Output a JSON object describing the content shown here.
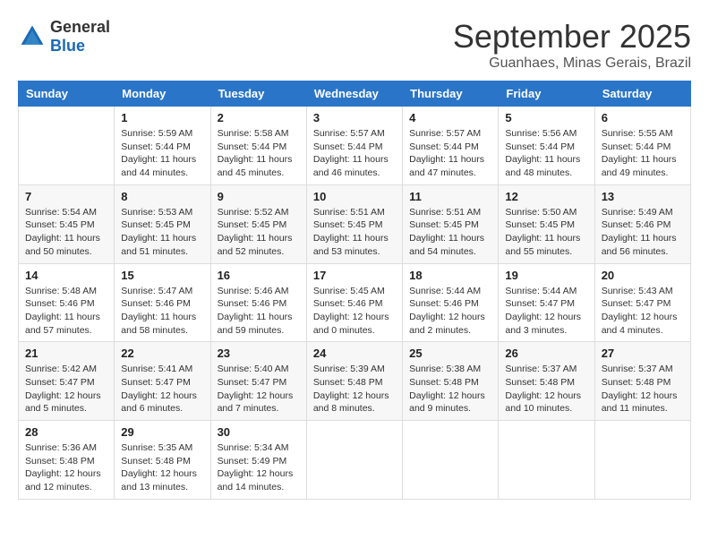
{
  "header": {
    "logo": {
      "general": "General",
      "blue": "Blue"
    },
    "title": "September 2025",
    "location": "Guanhaes, Minas Gerais, Brazil"
  },
  "weekdays": [
    "Sunday",
    "Monday",
    "Tuesday",
    "Wednesday",
    "Thursday",
    "Friday",
    "Saturday"
  ],
  "weeks": [
    [
      {
        "day": "",
        "sunrise": "",
        "sunset": "",
        "daylight": ""
      },
      {
        "day": "1",
        "sunrise": "Sunrise: 5:59 AM",
        "sunset": "Sunset: 5:44 PM",
        "daylight": "Daylight: 11 hours and 44 minutes."
      },
      {
        "day": "2",
        "sunrise": "Sunrise: 5:58 AM",
        "sunset": "Sunset: 5:44 PM",
        "daylight": "Daylight: 11 hours and 45 minutes."
      },
      {
        "day": "3",
        "sunrise": "Sunrise: 5:57 AM",
        "sunset": "Sunset: 5:44 PM",
        "daylight": "Daylight: 11 hours and 46 minutes."
      },
      {
        "day": "4",
        "sunrise": "Sunrise: 5:57 AM",
        "sunset": "Sunset: 5:44 PM",
        "daylight": "Daylight: 11 hours and 47 minutes."
      },
      {
        "day": "5",
        "sunrise": "Sunrise: 5:56 AM",
        "sunset": "Sunset: 5:44 PM",
        "daylight": "Daylight: 11 hours and 48 minutes."
      },
      {
        "day": "6",
        "sunrise": "Sunrise: 5:55 AM",
        "sunset": "Sunset: 5:44 PM",
        "daylight": "Daylight: 11 hours and 49 minutes."
      }
    ],
    [
      {
        "day": "7",
        "sunrise": "Sunrise: 5:54 AM",
        "sunset": "Sunset: 5:45 PM",
        "daylight": "Daylight: 11 hours and 50 minutes."
      },
      {
        "day": "8",
        "sunrise": "Sunrise: 5:53 AM",
        "sunset": "Sunset: 5:45 PM",
        "daylight": "Daylight: 11 hours and 51 minutes."
      },
      {
        "day": "9",
        "sunrise": "Sunrise: 5:52 AM",
        "sunset": "Sunset: 5:45 PM",
        "daylight": "Daylight: 11 hours and 52 minutes."
      },
      {
        "day": "10",
        "sunrise": "Sunrise: 5:51 AM",
        "sunset": "Sunset: 5:45 PM",
        "daylight": "Daylight: 11 hours and 53 minutes."
      },
      {
        "day": "11",
        "sunrise": "Sunrise: 5:51 AM",
        "sunset": "Sunset: 5:45 PM",
        "daylight": "Daylight: 11 hours and 54 minutes."
      },
      {
        "day": "12",
        "sunrise": "Sunrise: 5:50 AM",
        "sunset": "Sunset: 5:45 PM",
        "daylight": "Daylight: 11 hours and 55 minutes."
      },
      {
        "day": "13",
        "sunrise": "Sunrise: 5:49 AM",
        "sunset": "Sunset: 5:46 PM",
        "daylight": "Daylight: 11 hours and 56 minutes."
      }
    ],
    [
      {
        "day": "14",
        "sunrise": "Sunrise: 5:48 AM",
        "sunset": "Sunset: 5:46 PM",
        "daylight": "Daylight: 11 hours and 57 minutes."
      },
      {
        "day": "15",
        "sunrise": "Sunrise: 5:47 AM",
        "sunset": "Sunset: 5:46 PM",
        "daylight": "Daylight: 11 hours and 58 minutes."
      },
      {
        "day": "16",
        "sunrise": "Sunrise: 5:46 AM",
        "sunset": "Sunset: 5:46 PM",
        "daylight": "Daylight: 11 hours and 59 minutes."
      },
      {
        "day": "17",
        "sunrise": "Sunrise: 5:45 AM",
        "sunset": "Sunset: 5:46 PM",
        "daylight": "Daylight: 12 hours and 0 minutes."
      },
      {
        "day": "18",
        "sunrise": "Sunrise: 5:44 AM",
        "sunset": "Sunset: 5:46 PM",
        "daylight": "Daylight: 12 hours and 2 minutes."
      },
      {
        "day": "19",
        "sunrise": "Sunrise: 5:44 AM",
        "sunset": "Sunset: 5:47 PM",
        "daylight": "Daylight: 12 hours and 3 minutes."
      },
      {
        "day": "20",
        "sunrise": "Sunrise: 5:43 AM",
        "sunset": "Sunset: 5:47 PM",
        "daylight": "Daylight: 12 hours and 4 minutes."
      }
    ],
    [
      {
        "day": "21",
        "sunrise": "Sunrise: 5:42 AM",
        "sunset": "Sunset: 5:47 PM",
        "daylight": "Daylight: 12 hours and 5 minutes."
      },
      {
        "day": "22",
        "sunrise": "Sunrise: 5:41 AM",
        "sunset": "Sunset: 5:47 PM",
        "daylight": "Daylight: 12 hours and 6 minutes."
      },
      {
        "day": "23",
        "sunrise": "Sunrise: 5:40 AM",
        "sunset": "Sunset: 5:47 PM",
        "daylight": "Daylight: 12 hours and 7 minutes."
      },
      {
        "day": "24",
        "sunrise": "Sunrise: 5:39 AM",
        "sunset": "Sunset: 5:48 PM",
        "daylight": "Daylight: 12 hours and 8 minutes."
      },
      {
        "day": "25",
        "sunrise": "Sunrise: 5:38 AM",
        "sunset": "Sunset: 5:48 PM",
        "daylight": "Daylight: 12 hours and 9 minutes."
      },
      {
        "day": "26",
        "sunrise": "Sunrise: 5:37 AM",
        "sunset": "Sunset: 5:48 PM",
        "daylight": "Daylight: 12 hours and 10 minutes."
      },
      {
        "day": "27",
        "sunrise": "Sunrise: 5:37 AM",
        "sunset": "Sunset: 5:48 PM",
        "daylight": "Daylight: 12 hours and 11 minutes."
      }
    ],
    [
      {
        "day": "28",
        "sunrise": "Sunrise: 5:36 AM",
        "sunset": "Sunset: 5:48 PM",
        "daylight": "Daylight: 12 hours and 12 minutes."
      },
      {
        "day": "29",
        "sunrise": "Sunrise: 5:35 AM",
        "sunset": "Sunset: 5:48 PM",
        "daylight": "Daylight: 12 hours and 13 minutes."
      },
      {
        "day": "30",
        "sunrise": "Sunrise: 5:34 AM",
        "sunset": "Sunset: 5:49 PM",
        "daylight": "Daylight: 12 hours and 14 minutes."
      },
      {
        "day": "",
        "sunrise": "",
        "sunset": "",
        "daylight": ""
      },
      {
        "day": "",
        "sunrise": "",
        "sunset": "",
        "daylight": ""
      },
      {
        "day": "",
        "sunrise": "",
        "sunset": "",
        "daylight": ""
      },
      {
        "day": "",
        "sunrise": "",
        "sunset": "",
        "daylight": ""
      }
    ]
  ]
}
